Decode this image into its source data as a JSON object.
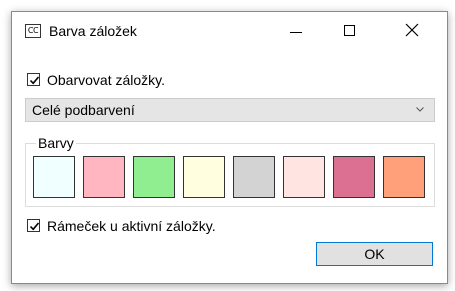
{
  "window": {
    "icon_text": "CC",
    "title": "Barva záložek"
  },
  "options": {
    "colorize_label": "Obarvovat záložky.",
    "colorize_checked": true,
    "mode_value": "Celé podbarvení",
    "border_label": "Rámeček u aktivní záložky.",
    "border_checked": true
  },
  "colors_group": {
    "label": "Barvy",
    "swatches": [
      "#f0ffff",
      "#ffb6c1",
      "#90ee90",
      "#ffffe0",
      "#d3d3d3",
      "#ffe4e1",
      "#db7093",
      "#ffa07a"
    ]
  },
  "buttons": {
    "ok_label": "OK"
  },
  "icons": {
    "minimize": "minimize-icon",
    "maximize": "maximize-icon",
    "close": "close-icon",
    "checkmark": "checkmark-icon",
    "chevron": "chevron-down-icon"
  }
}
